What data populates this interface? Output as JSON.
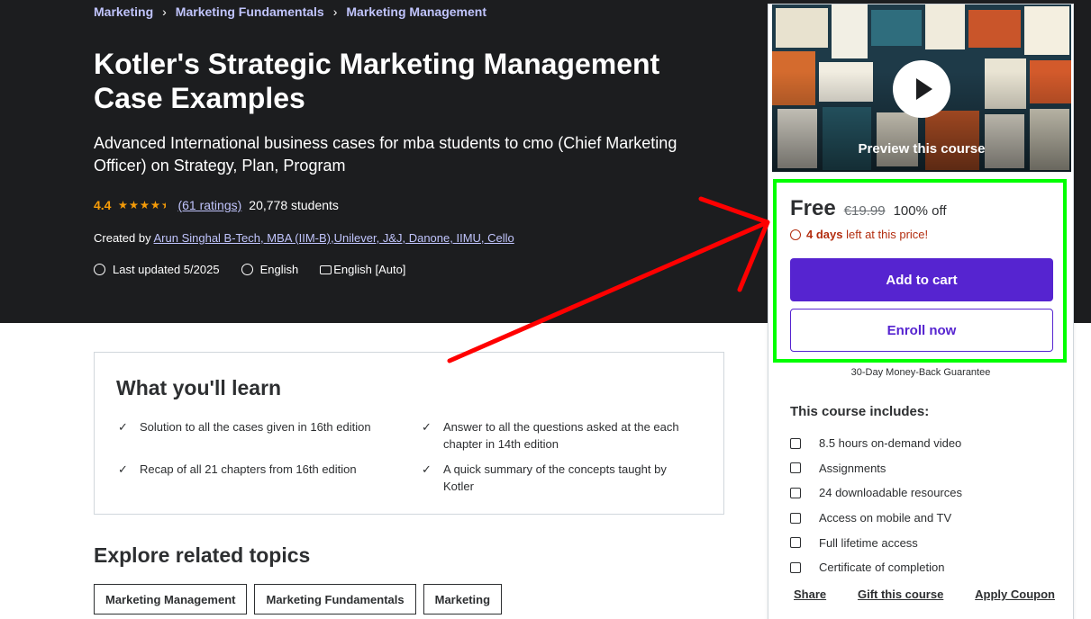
{
  "breadcrumb": [
    "Marketing",
    "Marketing Fundamentals",
    "Marketing Management"
  ],
  "course": {
    "title": "Kotler's Strategic Marketing Management Case Examples",
    "subtitle": "Advanced International business cases for mba students to cmo (Chief Marketing Officer) on Strategy, Plan, Program",
    "rating": "4.4",
    "rating_stars": 4.5,
    "ratings_count": "(61 ratings)",
    "students": "20,778 students",
    "created_by_label": "Created by",
    "instructor": "Arun Singhal B-Tech, MBA (IIM-B),Unilever, J&J, Danone, IIMU, Cello",
    "last_updated": "Last updated 5/2025",
    "language": "English",
    "captions": "English [Auto]"
  },
  "sidebar": {
    "preview_label": "Preview this course",
    "price": "Free",
    "original_price": "€19.99",
    "discount": "100% off",
    "timer_bold": "4 days",
    "timer_rest": "left at this price!",
    "add_to_cart": "Add to cart",
    "enroll_now": "Enroll now",
    "guarantee": "30-Day Money-Back Guarantee",
    "includes_title": "This course includes:",
    "includes": [
      {
        "icon": "video-icon",
        "label": "8.5 hours on-demand video"
      },
      {
        "icon": "assignment-icon",
        "label": "Assignments"
      },
      {
        "icon": "download-icon",
        "label": "24 downloadable resources"
      },
      {
        "icon": "mobile-icon",
        "label": "Access on mobile and TV"
      },
      {
        "icon": "infinity-icon",
        "label": "Full lifetime access"
      },
      {
        "icon": "trophy-icon",
        "label": "Certificate of completion"
      }
    ],
    "links": [
      "Share",
      "Gift this course",
      "Apply Coupon"
    ]
  },
  "learn": {
    "title": "What you'll learn",
    "items": [
      "Solution to all the cases given in 16th edition",
      "Answer to all the questions asked at the each chapter in 14th edition",
      "Recap of all 21 chapters from 16th edition",
      "A quick summary of the concepts taught by Kotler"
    ]
  },
  "explore": {
    "title": "Explore related topics",
    "topics": [
      "Marketing Management",
      "Marketing Fundamentals",
      "Marketing"
    ]
  },
  "colors": {
    "hero_bg": "#1c1d1f",
    "link": "#c0c4fc",
    "star": "#f69c08",
    "primary": "#5624d0",
    "timer": "#b32d0f",
    "annotation_box": "#00ff00",
    "annotation_arrow": "#ff0000"
  }
}
